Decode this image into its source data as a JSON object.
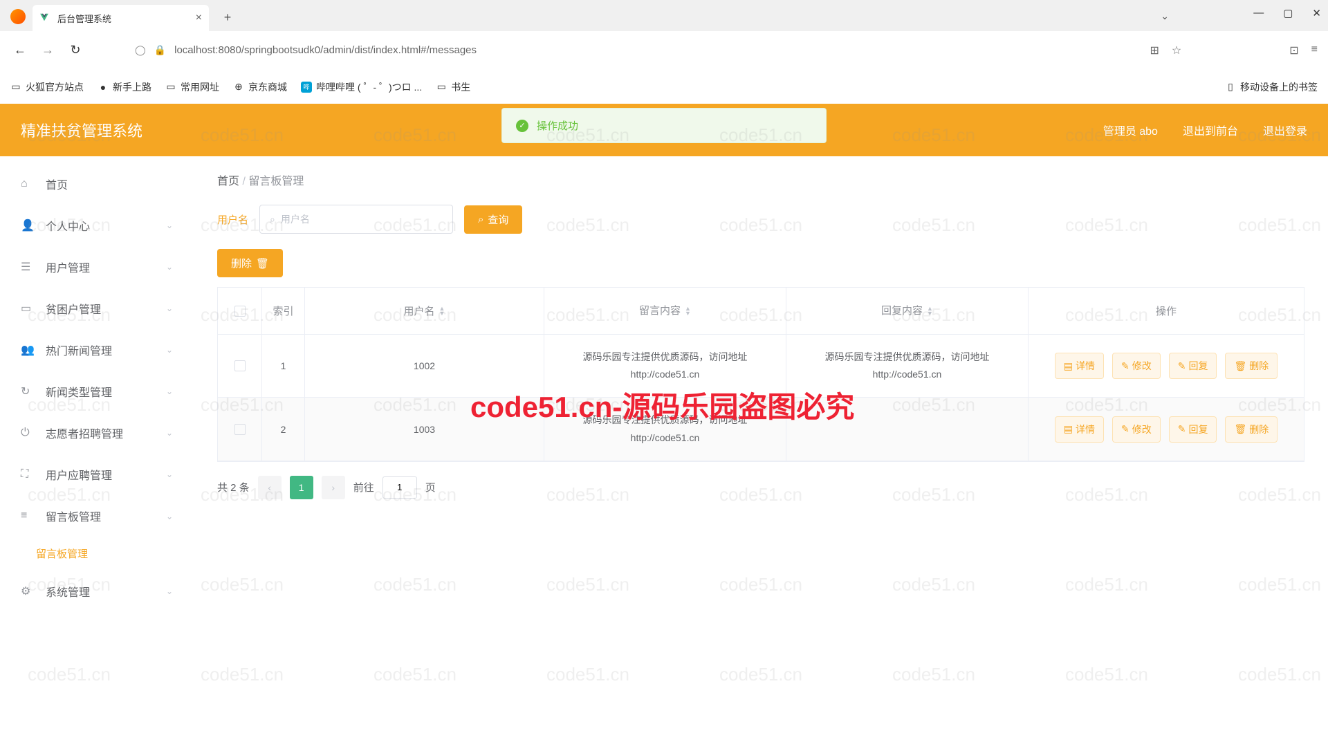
{
  "browser": {
    "tab_title": "后台管理系统",
    "url_display": "localhost:8080/springbootsudk0/admin/dist/index.html#/messages",
    "bookmarks": [
      "火狐官方站点",
      "新手上路",
      "常用网址",
      "京东商城",
      "哔哩哔哩 ( ゜- ゜)つロ ...",
      "书生"
    ],
    "mobile_bookmarks": "移动设备上的书签"
  },
  "toast": {
    "text": "操作成功"
  },
  "header": {
    "title": "精准扶贫管理系统",
    "admin": "管理员 abo",
    "to_front": "退出到前台",
    "logout": "退出登录"
  },
  "sidebar": {
    "items": [
      {
        "label": "首页",
        "icon": "home"
      },
      {
        "label": "个人中心",
        "icon": "user"
      },
      {
        "label": "用户管理",
        "icon": "menu"
      },
      {
        "label": "贫困户管理",
        "icon": "doc"
      },
      {
        "label": "热门新闻管理",
        "icon": "users"
      },
      {
        "label": "新闻类型管理",
        "icon": "refresh"
      },
      {
        "label": "志愿者招聘管理",
        "icon": "power"
      },
      {
        "label": "用户应聘管理",
        "icon": "expand"
      },
      {
        "label": "留言板管理",
        "icon": "list"
      },
      {
        "label": "系统管理",
        "icon": "gear"
      }
    ],
    "active_sub": "留言板管理"
  },
  "breadcrumb": {
    "home": "首页",
    "current": "留言板管理"
  },
  "search": {
    "label": "用户名",
    "placeholder": "用户名",
    "query_btn": "查询"
  },
  "batch_delete": "删除",
  "table": {
    "headers": {
      "index": "索引",
      "user": "用户名",
      "msg": "留言内容",
      "reply": "回复内容",
      "ops": "操作"
    },
    "rows": [
      {
        "idx": "1",
        "user": "1002",
        "msg": "源码乐园专注提供优质源码，访问地址http://code51.cn",
        "reply": "源码乐园专注提供优质源码，访问地址http://code51.cn"
      },
      {
        "idx": "2",
        "user": "1003",
        "msg": "源码乐园专注提供优质源码，访问地址http://code51.cn",
        "reply": ""
      }
    ],
    "ops": {
      "detail": "详情",
      "edit": "修改",
      "reply": "回复",
      "del": "删除"
    }
  },
  "pager": {
    "total": "共 2 条",
    "page": "1",
    "goto_pre": "前往",
    "goto_val": "1",
    "goto_suf": "页"
  },
  "watermark": {
    "small": "code51.cn",
    "big": "code51.cn-源码乐园盗图必究"
  },
  "chart_data": null
}
